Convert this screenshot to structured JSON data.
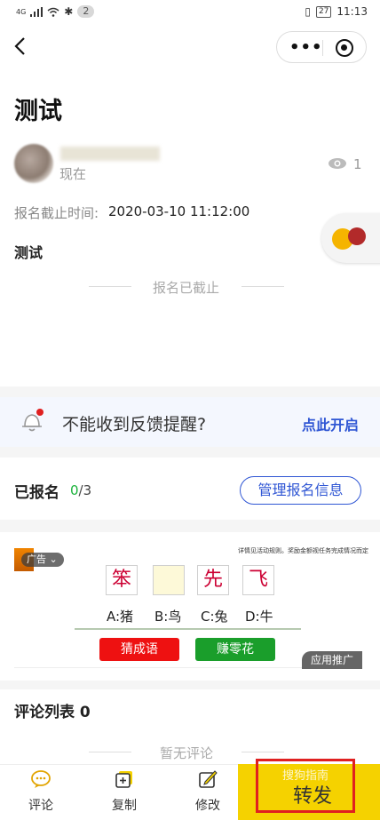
{
  "status_bar": {
    "network": "4G",
    "notif_count": "2",
    "battery": "27",
    "time": "11:13"
  },
  "nav": {
    "more_label": "•••"
  },
  "post": {
    "title": "测试",
    "time_label": "现在",
    "view_count": "1",
    "deadline_label": "报名截止时间:",
    "deadline_value": "2020-03-10 11:12:00",
    "content": "测试",
    "closed_notice": "报名已截止"
  },
  "reminder": {
    "text": "不能收到反馈提醒?",
    "link": "点此开启"
  },
  "registration": {
    "title": "已报名",
    "count_done": "0",
    "count_total": "/3",
    "manage_button": "管理报名信息"
  },
  "ad": {
    "badge": "广告",
    "small_text": "详情见活动规则。奖励金额视任务完成情况而定",
    "chars": [
      "笨",
      "",
      "先",
      "飞"
    ],
    "options": [
      "A:猪",
      "B:鸟",
      "C:兔",
      "D:牛"
    ],
    "btn_guess": "猜成语",
    "btn_earn": "赚零花",
    "tag": "应用推广"
  },
  "comments": {
    "title": "评论列表 0",
    "empty": "暂无评论"
  },
  "tabbar": {
    "items": [
      {
        "label": "评论",
        "icon": "comment-icon"
      },
      {
        "label": "复制",
        "icon": "copy-icon"
      },
      {
        "label": "修改",
        "icon": "edit-icon"
      }
    ],
    "share_label": "转发",
    "watermark": "搜狗指南"
  },
  "colors": {
    "accent_blue": "#2f56d4",
    "share_yellow": "#f5d200",
    "success_green": "#1bb33c"
  }
}
